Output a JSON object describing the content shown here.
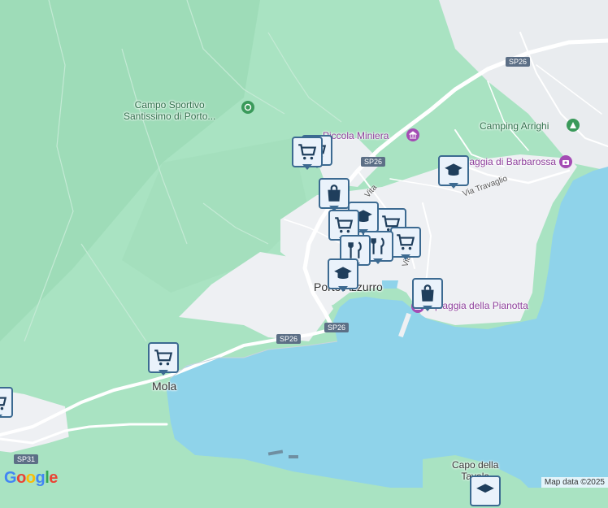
{
  "labels": {
    "campo_sportivo": "Campo Sportivo\nSantissimo di Porto...",
    "piccola_miniera": "Piccola Miniera",
    "camping_arrighi": "Camping Arrighi",
    "spiaggia_barbarossa": "Spiaggia di Barbarossa",
    "porto_azzurro": "Porto Azzurro",
    "spiaggia_pianotta": "Spiaggia della Pianotta",
    "mola": "Mola",
    "capo_tavola": "Capo della\nTavola"
  },
  "roads": {
    "sp26_a": "SP26",
    "sp26_b": "SP26",
    "sp26_c": "SP26",
    "sp26_d": "SP26",
    "sp31": "SP31"
  },
  "streets": {
    "via_travaglio": "Via Travaglio",
    "via_marino": "Via Marino",
    "vita": "Vita"
  },
  "markers": [
    {
      "type": "cart-icon"
    },
    {
      "type": "cart-icon"
    },
    {
      "type": "bag-icon"
    },
    {
      "type": "school-icon"
    },
    {
      "type": "cart-icon"
    },
    {
      "type": "school-icon"
    },
    {
      "type": "restaurant-icon"
    },
    {
      "type": "cart-icon"
    },
    {
      "type": "bag-icon"
    },
    {
      "type": "cart-icon"
    },
    {
      "type": "cart-icon"
    }
  ],
  "branding": {
    "logo": "Google",
    "attribution": "Map data ©2025"
  },
  "colors": {
    "water": "#8fd3ea",
    "land": "#a9e3c2",
    "urban": "#f0f1f4",
    "marker_border": "#3c6a91",
    "road_badge": "#5c6f86"
  }
}
